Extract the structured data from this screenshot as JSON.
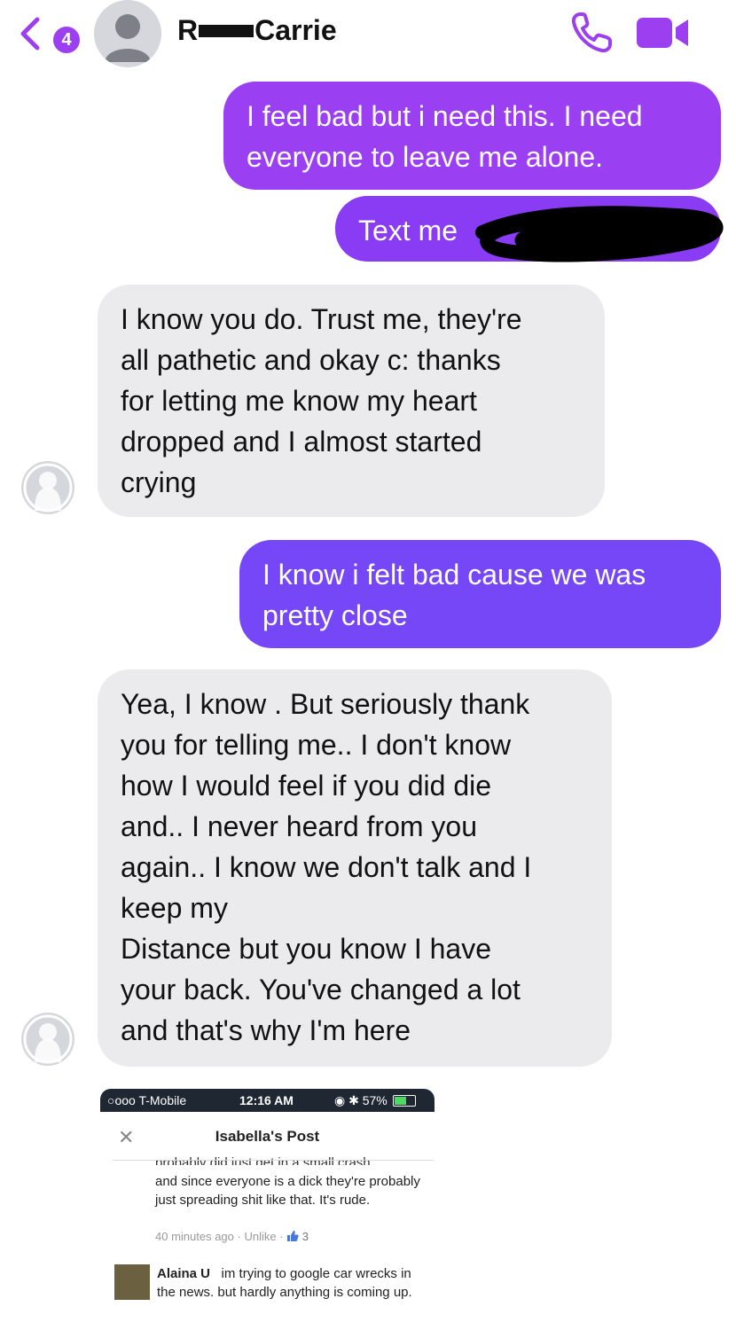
{
  "header": {
    "back_count": "4",
    "contact_first_initial": "R",
    "contact_last": "Carrie"
  },
  "messages": {
    "m1": "I feel bad but i need this. I need everyone to leave me alone.",
    "m2": "Text me",
    "m3_lines": [
      "I know you do. Trust me, they're",
      "all pathetic and okay c: thanks",
      "for letting me know my heart",
      "dropped and I almost started",
      "crying"
    ],
    "m4": "I know i felt bad cause we was pretty close",
    "m5_lines": [
      "Yea, I know . But seriously thank",
      "you for telling me.. I don't know",
      "how I would feel if you did die",
      "and.. I never heard from you",
      "again.. I know we don't talk and I",
      "keep my",
      "Distance but you know I have",
      "your back. You've changed a lot",
      "and that's why I'm here"
    ]
  },
  "colors": {
    "accent": "#9b3ff0",
    "bubble_1": "#9b3ff3",
    "bubble_2": "#8a3cf4",
    "bubble_4": "#7547f7",
    "incoming": "#ebebee"
  },
  "embedded": {
    "status_carrier": "○ooo T-Mobile",
    "status_time": "12:16 AM",
    "status_battery": "57%",
    "battery_level": 0.57,
    "title": "Isabella's Post",
    "cut_line": "probably did just get in a small crash",
    "post_text": "and since everyone is a dick they're probably just spreading shit like that. It's rude.",
    "post_time": "40 minutes ago",
    "unlike_label": "Unlike",
    "like_count": "3",
    "commenter": "Alaina U",
    "comment_text": "im trying to google car wrecks in the news. but hardly anything is coming up."
  }
}
